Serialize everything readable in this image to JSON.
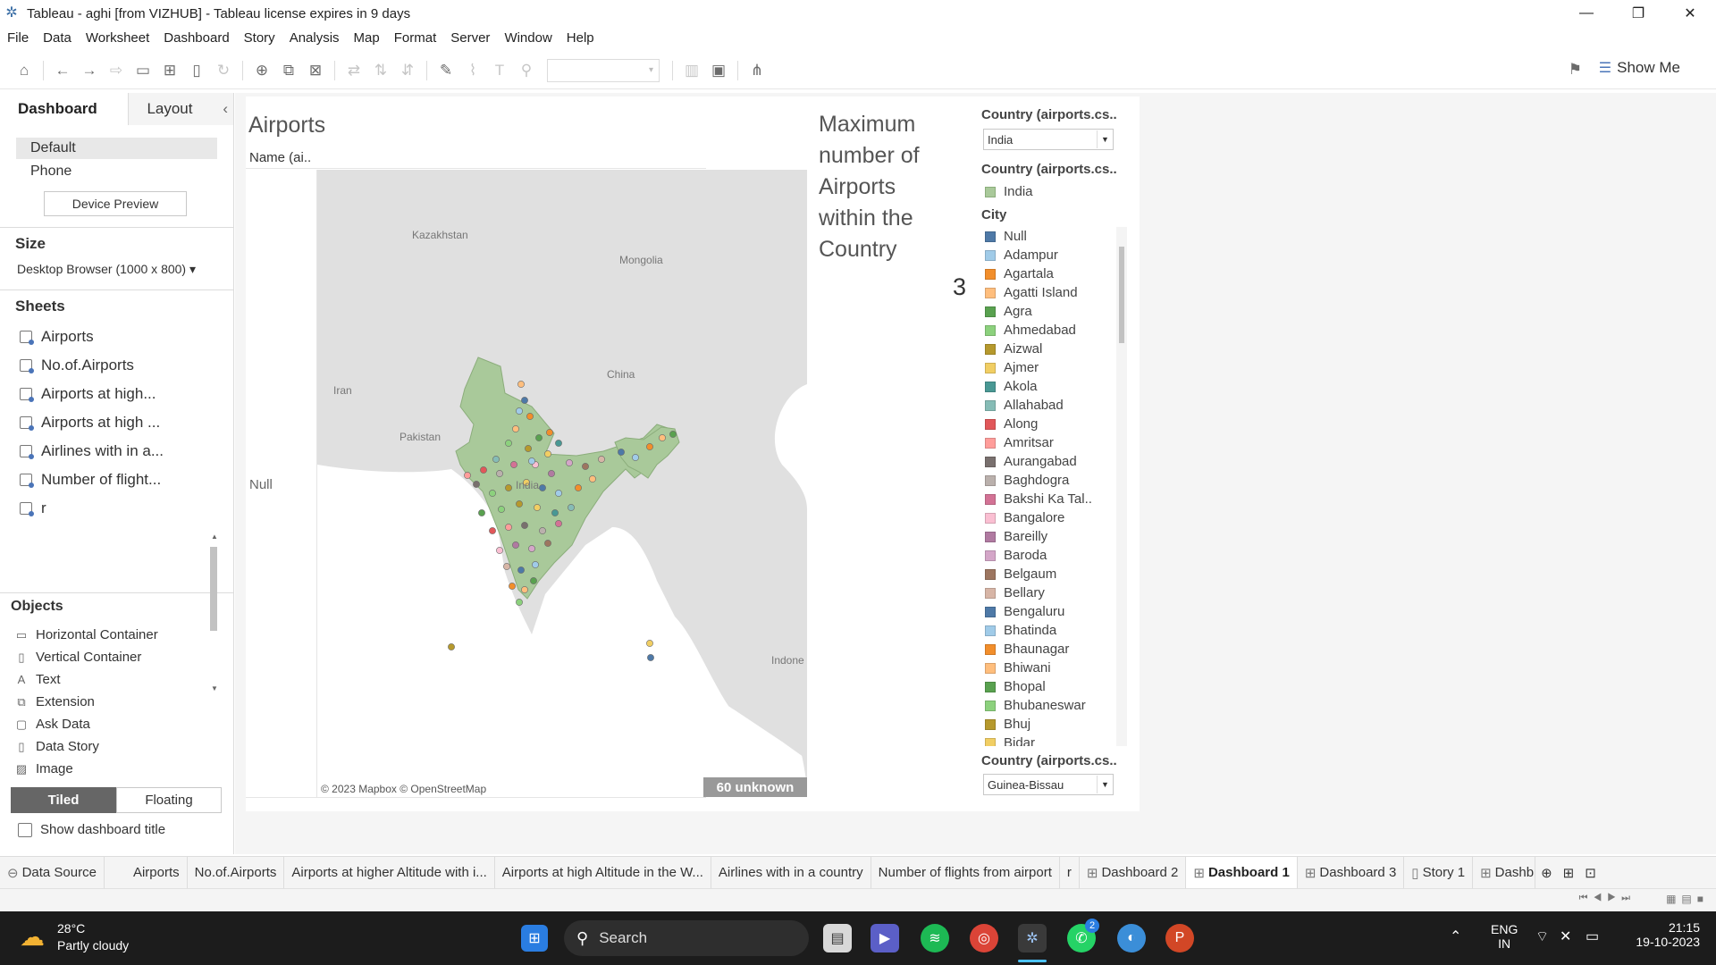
{
  "window": {
    "title": "Tableau - aghi [from VIZHUB] - Tableau license expires in 9 days"
  },
  "menu": [
    "File",
    "Data",
    "Worksheet",
    "Dashboard",
    "Story",
    "Analysis",
    "Map",
    "Format",
    "Server",
    "Window",
    "Help"
  ],
  "toolbar": {
    "show_me": "Show Me"
  },
  "left": {
    "tab_dashboard": "Dashboard",
    "tab_layout": "Layout",
    "device_default": "Default",
    "device_phone": "Phone",
    "device_preview": "Device Preview",
    "size_header": "Size",
    "size_value": "Desktop Browser (1000 x 800)",
    "sheets_header": "Sheets",
    "sheets": [
      "Airports",
      "No.of.Airports",
      "Airports at high...",
      "Airports at high ...",
      "Airlines with in a...",
      "Number of flight...",
      "r"
    ],
    "objects_header": "Objects",
    "objects": [
      "Horizontal Container",
      "Vertical Container",
      "Text",
      "Extension",
      "Ask Data",
      "Data Story",
      "Image"
    ],
    "tiled": "Tiled",
    "floating": "Floating",
    "show_title": "Show dashboard title"
  },
  "dashboard": {
    "airports_title": "Airports",
    "name_header": "Name (ai..",
    "null_label": "Null",
    "map_labels": [
      "Kazakhstan",
      "Mongolia",
      "Iran",
      "China",
      "Pakistan",
      "India",
      "Indone"
    ],
    "attribution": "© 2023 Mapbox © OpenStreetMap",
    "unknown_badge": "60 unknown",
    "max_title": "Maximum number of Airports within the Country",
    "max_value": "3",
    "filter1_label": "Country (airports.cs..",
    "filter1_value": "India",
    "legend_country_label": "Country (airports.cs..",
    "legend_country_value": "India",
    "city_header": "City",
    "cities": [
      "Null",
      "Adampur",
      "Agartala",
      "Agatti Island",
      "Agra",
      "Ahmedabad",
      "Aizwal",
      "Ajmer",
      "Akola",
      "Allahabad",
      "Along",
      "Amritsar",
      "Aurangabad",
      "Baghdogra",
      "Bakshi Ka Tal..",
      "Bangalore",
      "Bareilly",
      "Baroda",
      "Belgaum",
      "Bellary",
      "Bengaluru",
      "Bhatinda",
      "Bhaunagar",
      "Bhiwani",
      "Bhopal",
      "Bhubaneswar",
      "Bhuj",
      "Bidar"
    ],
    "city_colors": [
      "#4e79a7",
      "#a0cbe8",
      "#f28e2b",
      "#ffbe7d",
      "#59a14f",
      "#8cd17d",
      "#b6992d",
      "#f1ce63",
      "#499894",
      "#86bcb6",
      "#e15759",
      "#ff9d9a",
      "#79706e",
      "#bab0ac",
      "#d37295",
      "#fabfd2",
      "#b07aa1",
      "#d4a6c8",
      "#9d7660",
      "#d7b5a6",
      "#4e79a7",
      "#a0cbe8",
      "#f28e2b",
      "#ffbe7d",
      "#59a14f",
      "#8cd17d",
      "#b6992d",
      "#f1ce63"
    ],
    "filter2_label": "Country (airports.cs..",
    "filter2_value": "Guinea-Bissau"
  },
  "tabs": [
    "Data Source",
    "Airports",
    "No.of.Airports",
    "Airports at higher Altitude with i...",
    "Airports at high Altitude in the W...",
    "Airlines with in a country",
    "Number of flights from airport",
    "r",
    "Dashboard 2",
    "Dashboard 1",
    "Dashboard 3",
    "Story 1",
    "Dashb"
  ],
  "taskbar": {
    "weather_temp": "28°C",
    "weather_desc": "Partly cloudy",
    "search": "Search",
    "lang1": "ENG",
    "lang2": "IN",
    "time": "21:15",
    "date": "19-10-2023",
    "badge": "2"
  }
}
